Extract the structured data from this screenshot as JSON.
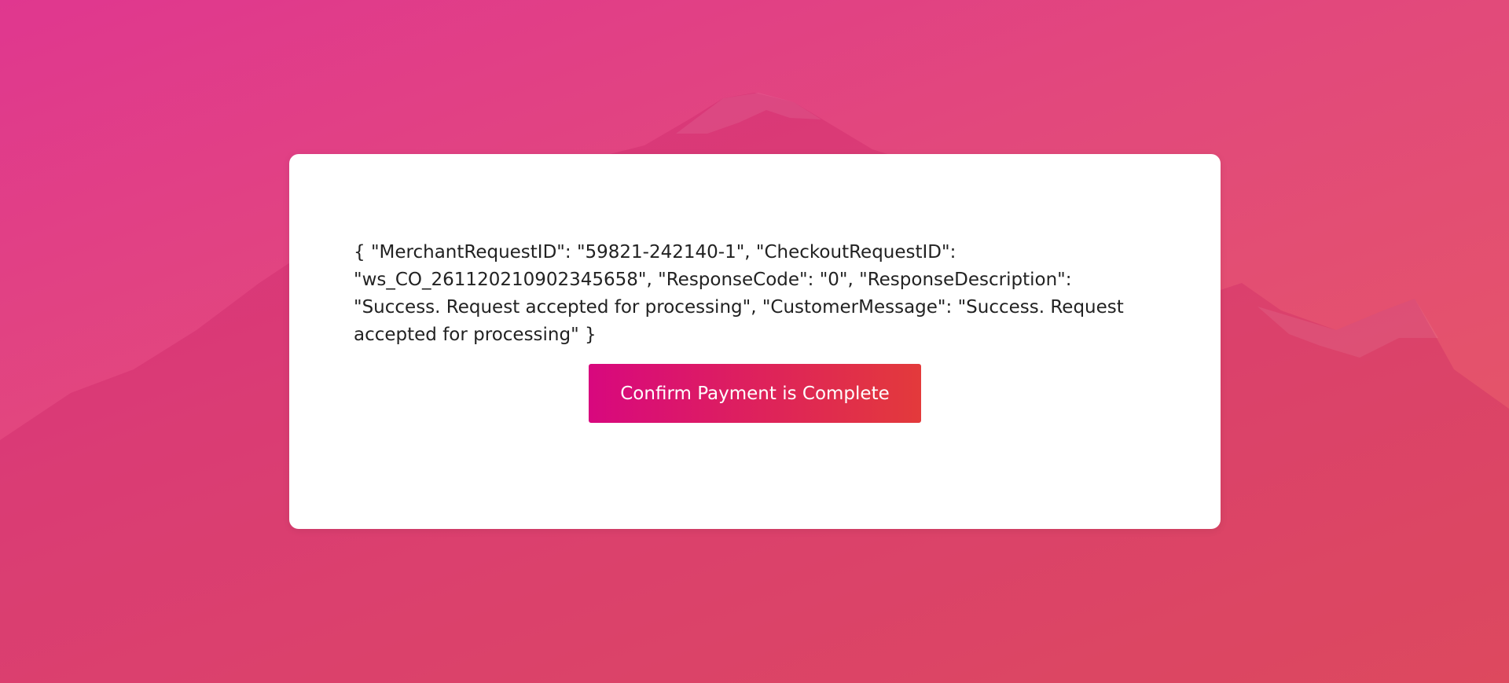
{
  "page": {
    "response_text": "{ \"MerchantRequestID\": \"59821-242140-1\", \"CheckoutRequestID\": \"ws_CO_261120210902345658\", \"ResponseCode\": \"0\", \"ResponseDescription\": \"Success. Request accepted for processing\", \"CustomerMessage\": \"Success. Request accepted for processing\" }",
    "confirm_button_label": "Confirm Payment is Complete"
  },
  "colors": {
    "background_start": "#e0378f",
    "background_end": "#e65a5e",
    "card": "#ffffff",
    "button_start": "#d8087e",
    "button_end": "#e33a3b",
    "text": "#222222",
    "button_text": "#ffffff"
  }
}
